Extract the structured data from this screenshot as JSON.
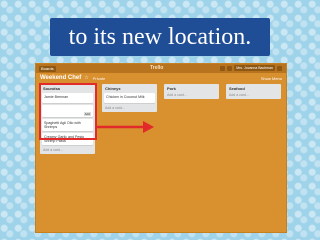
{
  "slide": {
    "caption": "to its new location."
  },
  "app": {
    "boards_label": "Boards",
    "logo": "Trello",
    "user_label": "Mrs. Jovanna Bachman",
    "board_title": "Weekend Chef",
    "privacy_label": "Private",
    "menu_label": "Show Menu"
  },
  "lists": [
    {
      "title": "Soundsa",
      "cards": [
        {
          "text": "Jamie Brennan",
          "badge": ""
        },
        {
          "text": "",
          "badge": "Add"
        },
        {
          "text": "Spaghetti Agli Olio with Shrimps",
          "badge": ""
        },
        {
          "text": "Creamy Garlic and Pesto Shrimp Pasta",
          "badge": ""
        }
      ],
      "add_label": "Add a card..."
    },
    {
      "title": "Chineyx",
      "cards": [
        {
          "text": "Chicken in Coconut Milk",
          "badge": ""
        }
      ],
      "add_label": "Add a card..."
    },
    {
      "title": "Pork",
      "cards": [],
      "add_label": "Add a card..."
    },
    {
      "title": "Seafood",
      "cards": [],
      "add_label": "Add a card..."
    }
  ],
  "colors": {
    "banner": "#1f4d96",
    "board_bg": "#d9902e",
    "highlight": "#e22a2a",
    "arrow": "#e22a2a"
  }
}
